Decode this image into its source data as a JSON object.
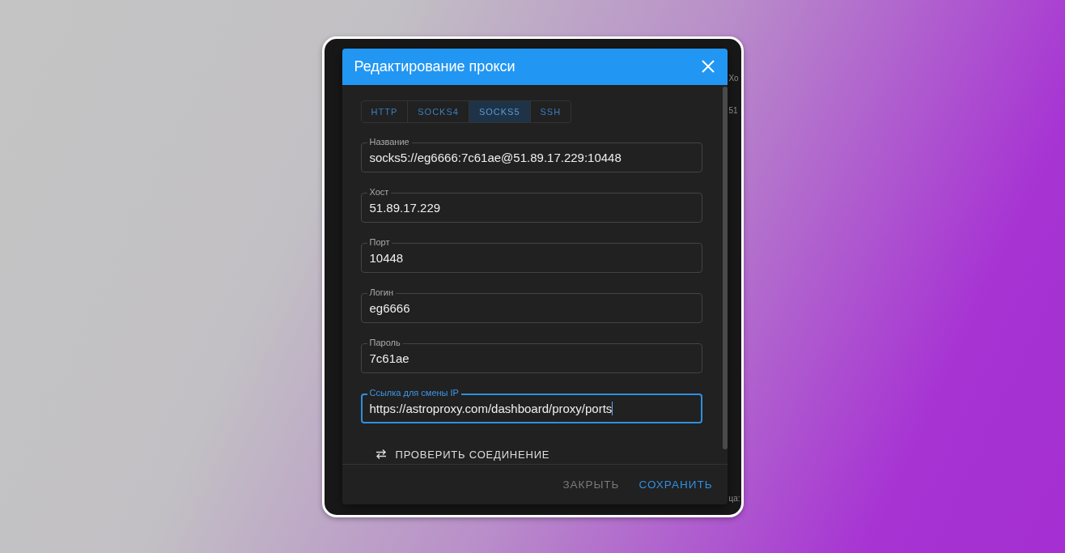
{
  "window": {
    "title": "Редактирование прокси"
  },
  "tabs": [
    {
      "label": "HTTP",
      "selected": false
    },
    {
      "label": "SOCKS4",
      "selected": false
    },
    {
      "label": "SOCKS5",
      "selected": true
    },
    {
      "label": "SSH",
      "selected": false
    }
  ],
  "fields": [
    {
      "label": "Название",
      "value": "socks5://eg6666:7c61ae@51.89.17.229:10448",
      "focused": false
    },
    {
      "label": "Хост",
      "value": "51.89.17.229",
      "focused": false
    },
    {
      "label": "Порт",
      "value": "10448",
      "focused": false
    },
    {
      "label": "Логин",
      "value": "eg6666",
      "focused": false
    },
    {
      "label": "Пароль",
      "value": "7c61ae",
      "focused": false
    },
    {
      "label": "Ссылка для смены IP",
      "value": "https://astroproxy.com/dashboard/proxy/ports",
      "focused": true
    }
  ],
  "test_button": {
    "label": "ПРОВЕРИТЬ СОЕДИНЕНИЕ"
  },
  "buttons": [
    {
      "label": "ЗАКРЫТЬ",
      "kind": "secondary"
    },
    {
      "label": "СОХРАНИТЬ",
      "kind": "primary"
    }
  ],
  "backdrop_texts": [
    "Хо",
    "51",
    "ца:"
  ]
}
